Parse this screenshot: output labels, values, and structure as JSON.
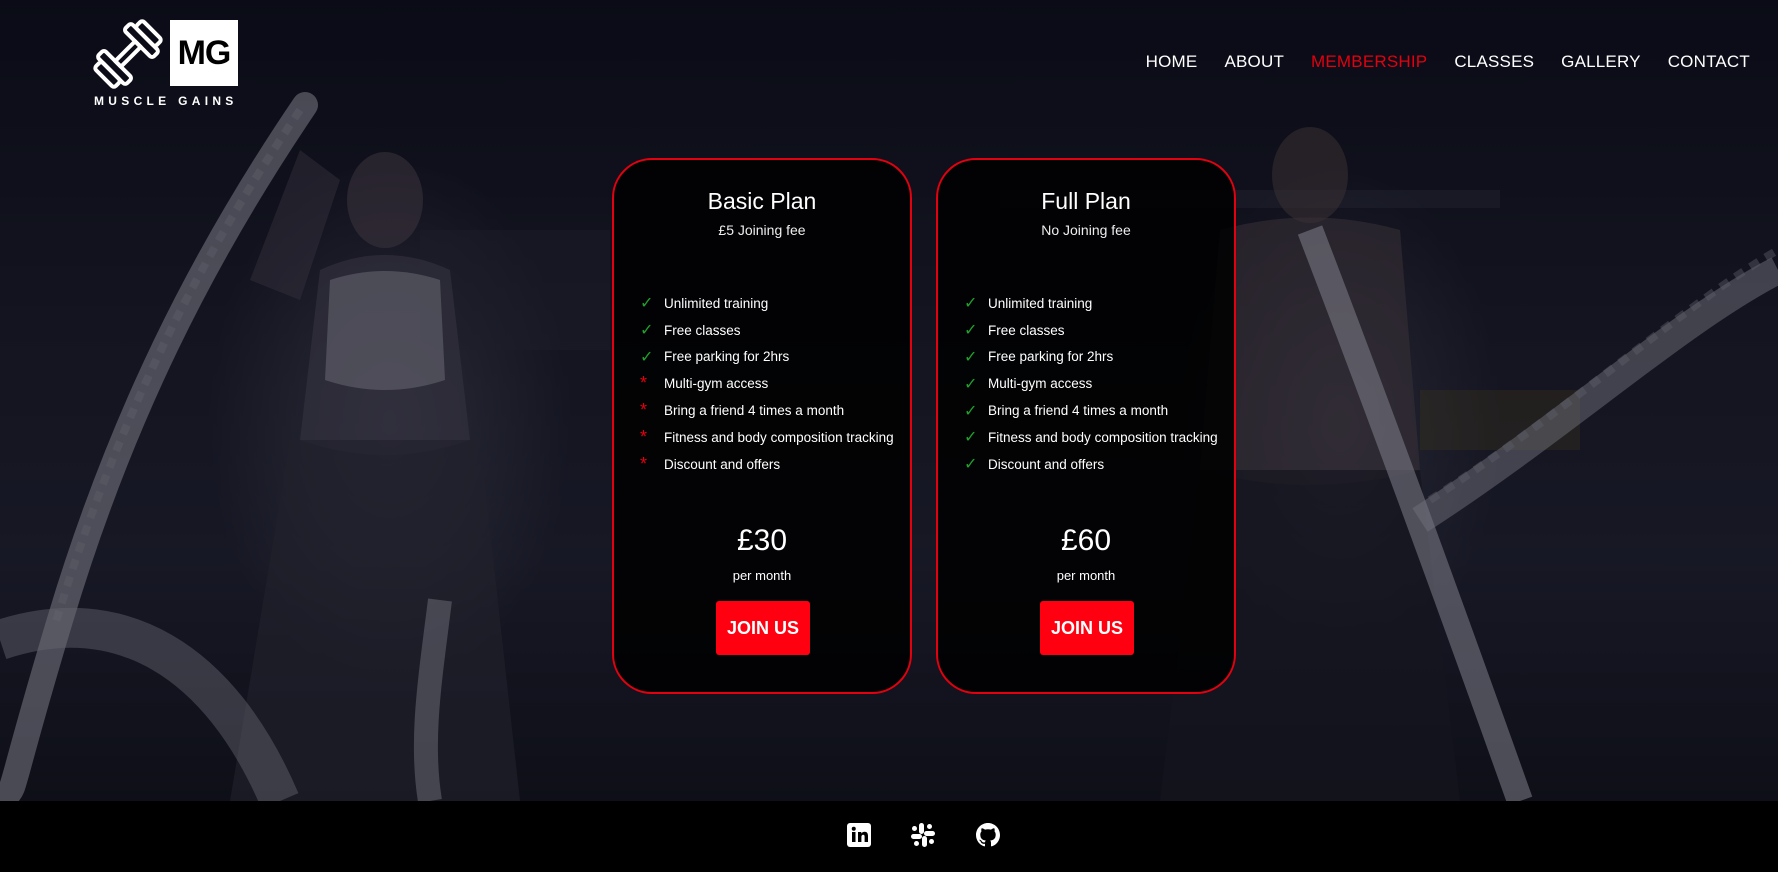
{
  "brand": {
    "initials": "MG",
    "name": "MUSCLE GAINS",
    "logo_icon": "dumbbell-icon"
  },
  "nav": {
    "items": [
      {
        "label": "HOME",
        "active": false
      },
      {
        "label": "ABOUT",
        "active": false
      },
      {
        "label": "MEMBERSHIP",
        "active": true
      },
      {
        "label": "CLASSES",
        "active": false
      },
      {
        "label": "GALLERY",
        "active": false
      },
      {
        "label": "CONTACT",
        "active": false
      }
    ],
    "active_color": "#e3000f"
  },
  "plans": [
    {
      "title": "Basic Plan",
      "subtitle": "£5 Joining fee",
      "features": [
        {
          "label": "Unlimited training",
          "included": true
        },
        {
          "label": "Free classes",
          "included": true
        },
        {
          "label": "Free parking for 2hrs",
          "included": true
        },
        {
          "label": "Multi-gym access",
          "included": false
        },
        {
          "label": "Bring a friend 4 times a month",
          "included": false
        },
        {
          "label": "Fitness and body composition tracking",
          "included": false
        },
        {
          "label": "Discount and offers",
          "included": false
        }
      ],
      "price": "£30",
      "period": "per month",
      "cta": "JOIN US"
    },
    {
      "title": "Full Plan",
      "subtitle": "No Joining fee",
      "features": [
        {
          "label": "Unlimited training",
          "included": true
        },
        {
          "label": "Free classes",
          "included": true
        },
        {
          "label": "Free parking for 2hrs",
          "included": true
        },
        {
          "label": "Multi-gym access",
          "included": true
        },
        {
          "label": "Bring a friend 4 times a month",
          "included": true
        },
        {
          "label": "Fitness and body composition tracking",
          "included": true
        },
        {
          "label": "Discount and offers",
          "included": true
        }
      ],
      "price": "£60",
      "period": "per month",
      "cta": "JOIN US"
    }
  ],
  "icons": {
    "included": "✓",
    "excluded": "*"
  },
  "colors": {
    "accent": "#e3000f",
    "check": "#1fa12c",
    "button": "#ff0010"
  },
  "footer": {
    "social": [
      "linkedin-icon",
      "slack-icon",
      "github-icon"
    ]
  }
}
